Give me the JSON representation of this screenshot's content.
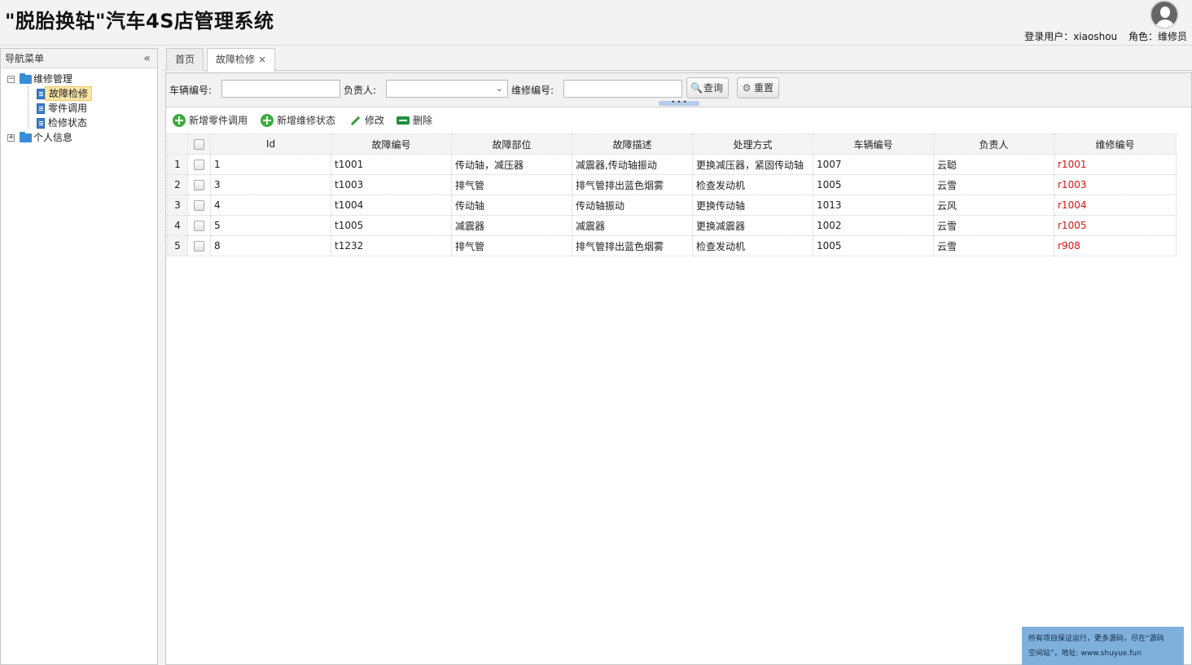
{
  "app": {
    "title": "\"脱胎换轱\"汽车4S店管理系统"
  },
  "user": {
    "login_label": "登录用户：",
    "login_name": "xiaoshou",
    "role_label": "角色：",
    "role_name": "维修员"
  },
  "sidebar": {
    "header": "导航菜单",
    "collapse_glyph": "«",
    "tree": {
      "group1": {
        "label": "维修管理",
        "expander": "−"
      },
      "items": [
        {
          "label": "故障检修"
        },
        {
          "label": "零件调用"
        },
        {
          "label": "检修状态"
        }
      ],
      "group2": {
        "label": "个人信息",
        "expander": "+"
      }
    }
  },
  "tabs": [
    {
      "label": "首页"
    },
    {
      "label": "故障检修",
      "close": "×"
    }
  ],
  "search": {
    "vehicle_label": "车辆编号:",
    "owner_label": "负责人:",
    "repair_label": "维修编号:",
    "query_button": "查询",
    "reset_button": "重置",
    "grip": "• • •"
  },
  "toolbar": {
    "add_part": "新增零件调用",
    "add_status": "新增维修状态",
    "edit": "修改",
    "delete": "删除"
  },
  "table": {
    "columns": [
      "Id",
      "故障编号",
      "故障部位",
      "故障描述",
      "处理方式",
      "车辆编号",
      "负责人",
      "维修编号"
    ],
    "rows": [
      {
        "n": "1",
        "id": "1",
        "code": "t1001",
        "part": "传动轴，减压器",
        "desc": "减震器,传动轴振动",
        "method": "更换减压器，紧固传动轴",
        "vehicle": "1007",
        "owner": "云聪",
        "repair": "r1001"
      },
      {
        "n": "2",
        "id": "3",
        "code": "t1003",
        "part": "排气管",
        "desc": "排气管排出蓝色烟雾",
        "method": "检查发动机",
        "vehicle": "1005",
        "owner": "云雪",
        "repair": "r1003"
      },
      {
        "n": "3",
        "id": "4",
        "code": "t1004",
        "part": "传动轴",
        "desc": "传动轴振动",
        "method": "更换传动轴",
        "vehicle": "1013",
        "owner": "云风",
        "repair": "r1004"
      },
      {
        "n": "4",
        "id": "5",
        "code": "t1005",
        "part": "减震器",
        "desc": "减震器",
        "method": "更换减震器",
        "vehicle": "1002",
        "owner": "云雪",
        "repair": "r1005"
      },
      {
        "n": "5",
        "id": "8",
        "code": "t1232",
        "part": "排气管",
        "desc": "排气管排出蓝色烟雾",
        "method": "检查发动机",
        "vehicle": "1005",
        "owner": "云雪",
        "repair": "r908"
      }
    ]
  },
  "promo": {
    "line1": "所有项目保证运行，更多源码，尽在“源码",
    "line2": "空间站”，地址: www.shuyue.fun"
  },
  "colors": {
    "accent_blue": "#3a8ed8",
    "selected_item": "#fbe6a5",
    "repair_code": "#dd1111",
    "promo_bg": "#7fb0dc"
  }
}
